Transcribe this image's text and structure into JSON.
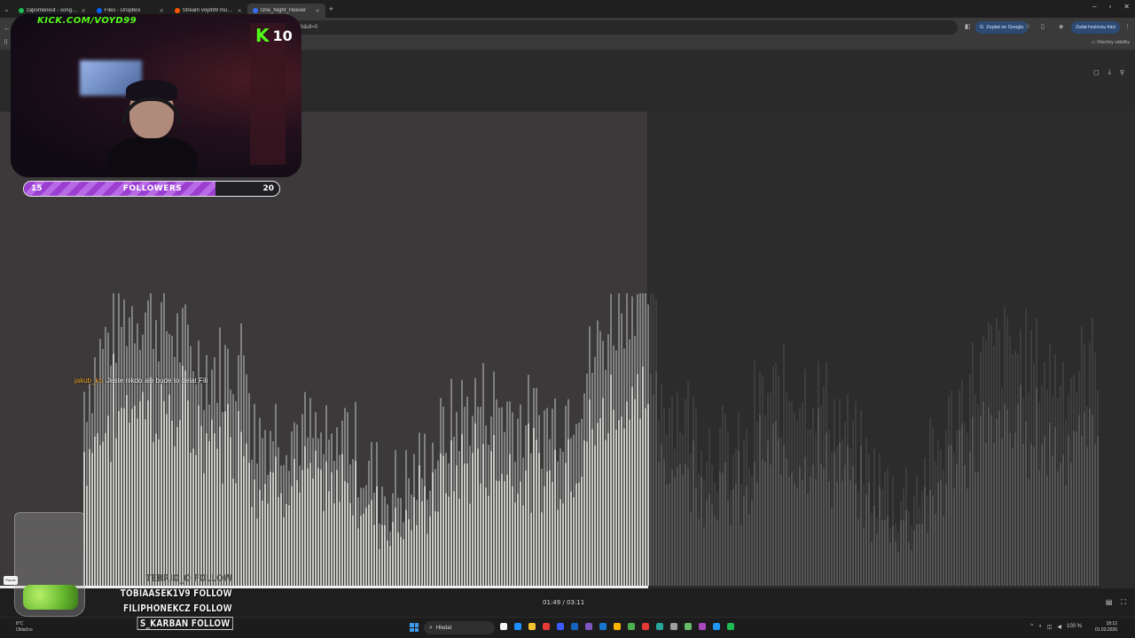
{
  "browser": {
    "tabs": [
      {
        "title": "zapomeneut - song and lyrics",
        "color": "#1db954"
      },
      {
        "title": "Files - Dropbox",
        "color": "#0061fe"
      },
      {
        "title": "Stream voyd99 music | Listen t",
        "color": "#ff5500"
      },
      {
        "title": "One_Night_Hoever",
        "color": "#3b6cf6",
        "active": true
      }
    ],
    "url": "rlkey=...&st=...&dl=0",
    "url_visible": "?b&dl=0",
    "ask_google": "Zeptat se Googlu",
    "password_btn": "Zadat heslovou frázi",
    "bookmarks_all": "Všechny záložky"
  },
  "player": {
    "time": "01:49 / 03:11",
    "progress": 0.571
  },
  "overlay": {
    "kick_url": "KICK.COM/VOYD99",
    "kick_viewers": "10",
    "followers_label": "FOLLOWERS",
    "followers_current": "15",
    "followers_target": "20",
    "followers_progress": 0.75,
    "chat": {
      "user": "jakub_ko",
      "message": "Jeste nikdo ale bude to delat Fili"
    },
    "follows": [
      {
        "text": "TERRIO_O FOLLOW",
        "style": "dim"
      },
      {
        "text": "TOBIAASEK1V9 FOLLOW",
        "style": "normal"
      },
      {
        "text": "FILIPHONEKCZ FOLLOW",
        "style": "normal"
      },
      {
        "text": "S_KARBAN FOLLOW",
        "style": "hl"
      }
    ],
    "pause_tip": "Pause"
  },
  "taskbar": {
    "weather_temp": "8°C",
    "weather_desc": "Oblačno",
    "search": "Hledat",
    "battery": "100 %",
    "time": "18:12",
    "date": "01.03.2026",
    "apps": [
      "#f5f5f5",
      "#1e90ff",
      "#f4c430",
      "#e53935",
      "#3d5afe",
      "#1565c0",
      "#7e57c2",
      "#1976d2",
      "#ffb300",
      "#4caf50",
      "#e53935",
      "#26a69a",
      "#9e9e9e",
      "#66bb6a",
      "#ab47bc",
      "#2196f3",
      "#1db954"
    ]
  }
}
